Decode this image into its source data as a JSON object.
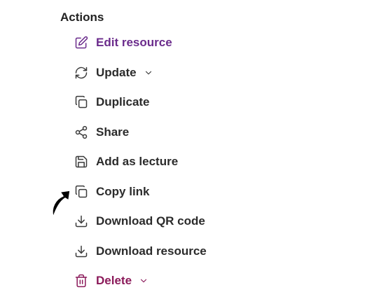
{
  "section": {
    "heading": "Actions"
  },
  "actions": [
    {
      "label": "Edit resource",
      "icon": "edit-icon",
      "color": "#6b2c8c"
    },
    {
      "label": "Update",
      "icon": "refresh-icon",
      "has_dropdown": true
    },
    {
      "label": "Duplicate",
      "icon": "copy-icon"
    },
    {
      "label": "Share",
      "icon": "share-icon"
    },
    {
      "label": "Add as lecture",
      "icon": "save-icon"
    },
    {
      "label": "Copy link",
      "icon": "copy-icon"
    },
    {
      "label": "Download QR code",
      "icon": "download-icon"
    },
    {
      "label": "Download resource",
      "icon": "download-icon"
    },
    {
      "label": "Delete",
      "icon": "trash-icon",
      "has_dropdown": true,
      "color": "#8b1a5a"
    }
  ],
  "colors": {
    "accent": "#6b2c8c",
    "danger": "#8b1a5a",
    "text": "#2b2b2b"
  }
}
